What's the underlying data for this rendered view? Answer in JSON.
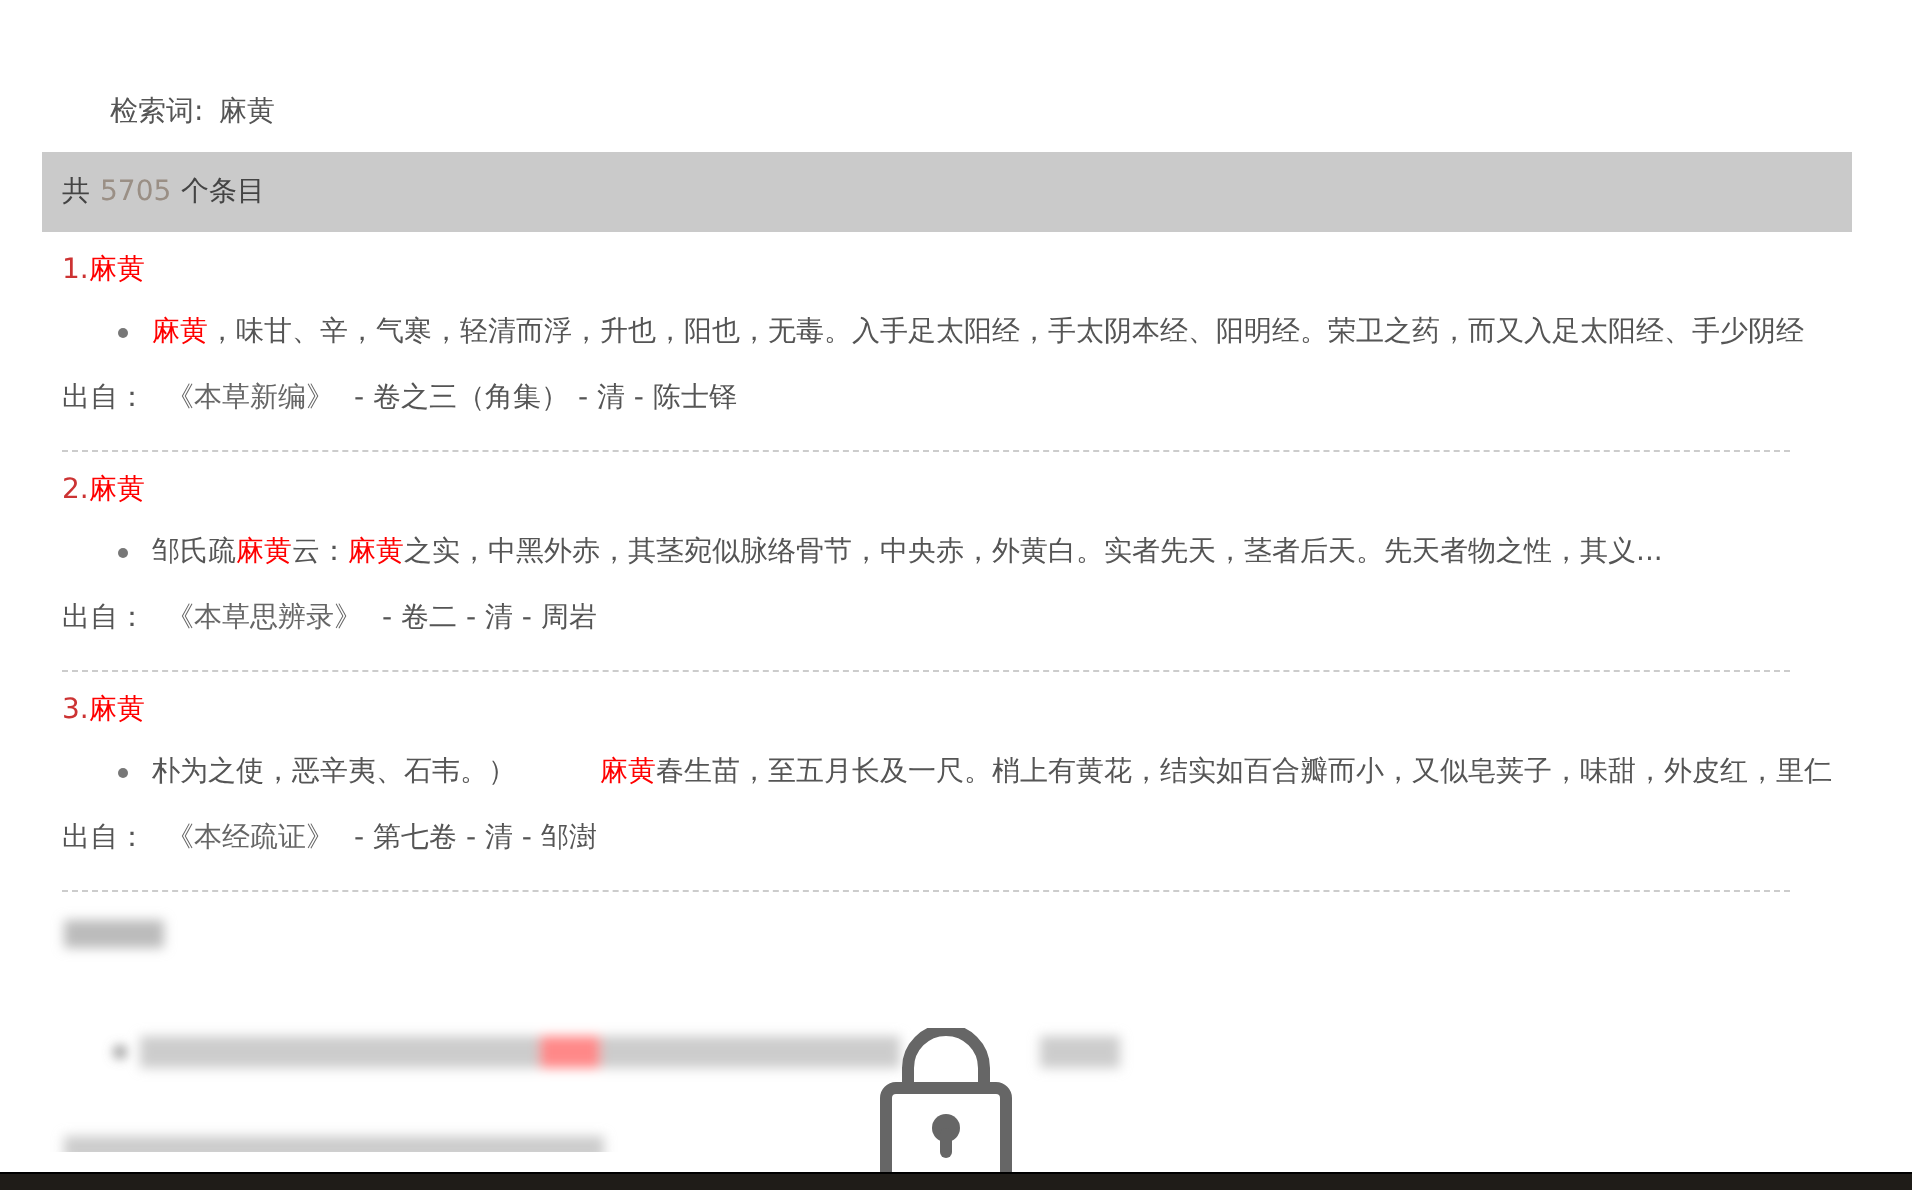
{
  "query": {
    "label": "检索词:",
    "value": "麻黄"
  },
  "count": {
    "prefix": "共",
    "number": "5705",
    "suffix": "个条目"
  },
  "entries": [
    {
      "index": "1.",
      "title": "麻黄",
      "snippet": [
        {
          "text": "麻黄",
          "highlight": true
        },
        {
          "text": "，味甘、辛，气寒，轻清而浮，升也，阳也，无毒。入手足太阳经，手太阴本经、阳明经。荣卫之药，而又入足太阳经、手少阴经",
          "highlight": false
        }
      ],
      "source_label": "出自：",
      "book": "《本草新编》",
      "rest": "- 卷之三（角集） - 清 - 陈士铎"
    },
    {
      "index": "2.",
      "title": "麻黄",
      "snippet": [
        {
          "text": "邹氏疏",
          "highlight": false
        },
        {
          "text": "麻黄",
          "highlight": true
        },
        {
          "text": "云：",
          "highlight": false
        },
        {
          "text": "麻黄",
          "highlight": true
        },
        {
          "text": "之实，中黑外赤，其茎宛似脉络骨节，中央赤，外黄白。实者先天，茎者后天。先天者物之性，其义...",
          "highlight": false
        }
      ],
      "source_label": "出自：",
      "book": "《本草思辨录》",
      "rest": "- 卷二 - 清 - 周岩"
    },
    {
      "index": "3.",
      "title": "麻黄",
      "snippet": [
        {
          "text": "朴为之使，恶辛夷、石韦。）　　　",
          "highlight": false
        },
        {
          "text": "麻黄",
          "highlight": true
        },
        {
          "text": "春生苗，至五月长及一尺。梢上有黄花，结实如百合瓣而小，又似皂荚子，味甜，外皮红，里仁",
          "highlight": false
        }
      ],
      "source_label": "出自：",
      "book": "《本经疏证》",
      "rest": "- 第七卷 - 清 - 邹澍"
    }
  ]
}
